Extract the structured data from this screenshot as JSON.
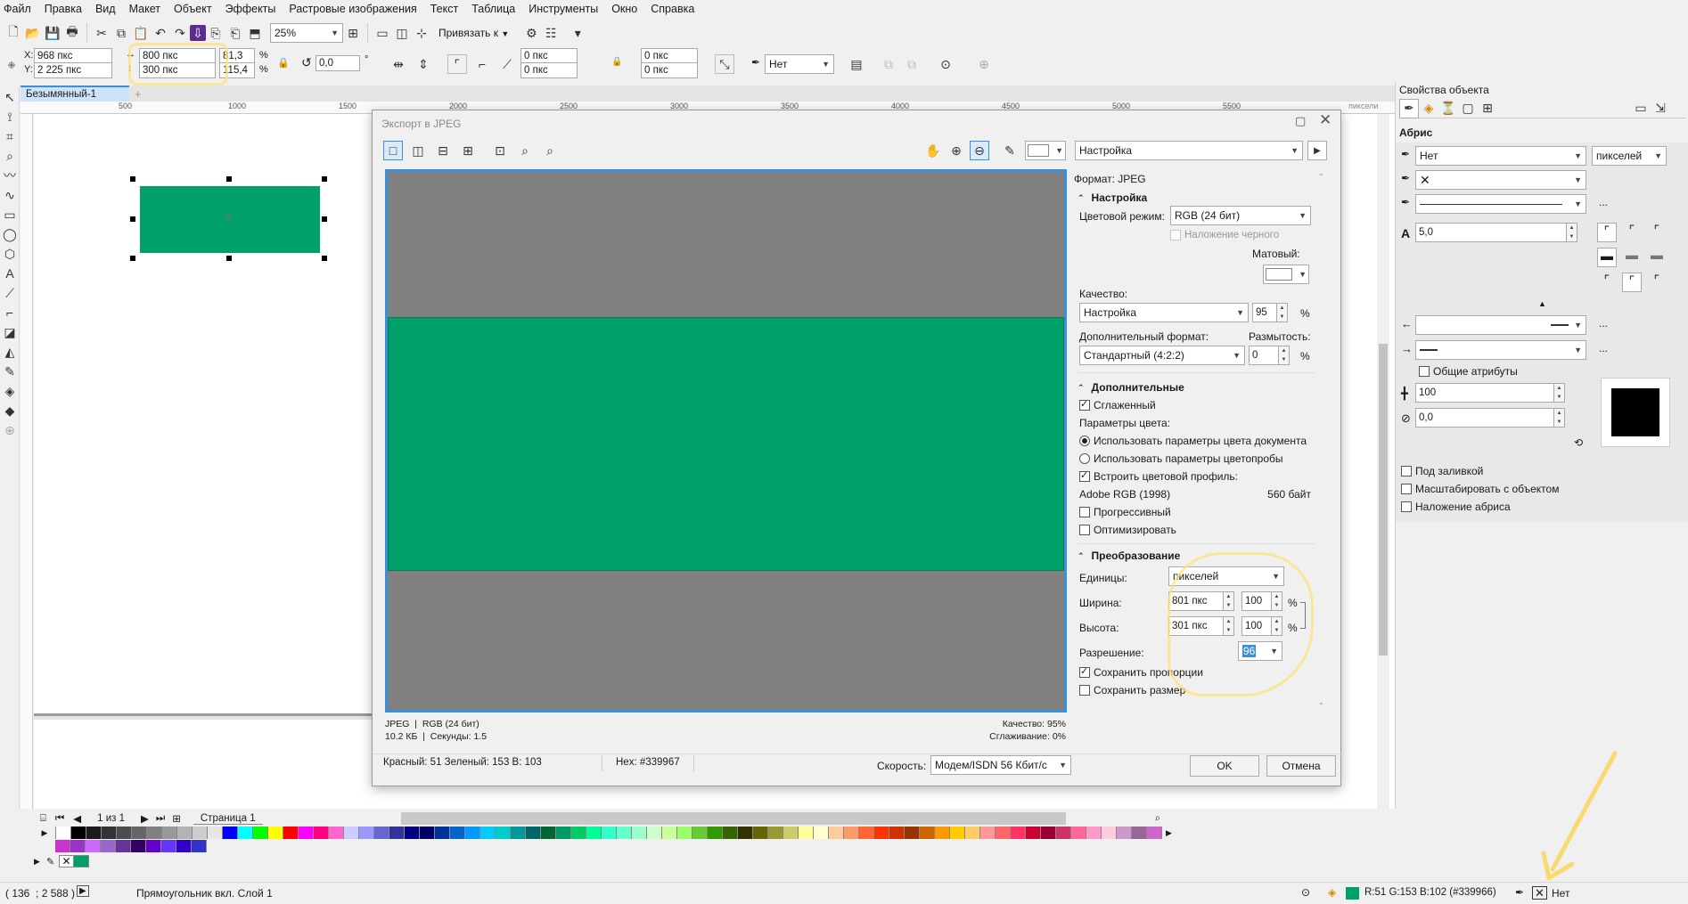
{
  "menu": [
    "Файл",
    "Правка",
    "Вид",
    "Макет",
    "Объект",
    "Эффекты",
    "Растровые изображения",
    "Текст",
    "Таблица",
    "Инструменты",
    "Окно",
    "Справка"
  ],
  "toolbar": {
    "zoom": "25%",
    "snap_label": "Привязать к"
  },
  "propbar": {
    "x_label": "X:",
    "x": "968 пкс",
    "y_label": "Y:",
    "y": "2 225 пкс",
    "w": "800 пкс",
    "h": "300 пкс",
    "w_pct": "81,3",
    "h_pct": "115,4",
    "pct": "%",
    "angle": "0,0",
    "deg": "°",
    "c1": "0 пкс",
    "c2": "0 пкс",
    "c3": "0 пкс",
    "c4": "0 пкс",
    "outline": "Нет"
  },
  "doc_tab": "Безымянный-1",
  "ruler": {
    "ticks": [
      "500",
      "1000",
      "1500",
      "2000",
      "2500",
      "3000",
      "3500",
      "4000",
      "4500",
      "5000",
      "5500"
    ],
    "unit": "пиксели"
  },
  "dialog": {
    "title": "Экспорт в JPEG",
    "preset": "Настройка",
    "format_label": "Формат: JPEG",
    "settings": {
      "header": "Настройка",
      "color_mode_label": "Цветовой режим:",
      "color_mode": "RGB (24 бит)",
      "overprint": "Наложение черного",
      "matte_label": "Матовый:",
      "quality_label": "Качество:",
      "quality": "Настройка",
      "quality_value": "95",
      "pct": "%",
      "subformat_label": "Дополнительный формат:",
      "subformat": "Стандартный (4:2:2)",
      "blur_label": "Размытость:",
      "blur_value": "0"
    },
    "advanced": {
      "header": "Дополнительные",
      "antialias": "Сглаженный",
      "color_params": "Параметры цвета:",
      "use_doc": "Использовать параметры цвета документа",
      "use_proof": "Использовать параметры цветопробы",
      "embed": "Встроить цветовой профиль:",
      "profile": "Adobe RGB (1998)",
      "profile_size": "560 байт",
      "progressive": "Прогрессивный",
      "optimize": "Оптимизировать"
    },
    "transform": {
      "header": "Преобразование",
      "units_label": "Единицы:",
      "units": "пикселей",
      "width_label": "Ширина:",
      "width": "801 пкс",
      "width_pct": "100",
      "height_label": "Высота:",
      "height": "301 пкс",
      "height_pct": "100",
      "pct": "%",
      "res_label": "Разрешение:",
      "res": "96",
      "keep_ratio": "Сохранить пропорции",
      "keep_size": "Сохранить размер"
    },
    "preview_info": {
      "left1": "JPEG  |  RGB (24 бит)",
      "left2": "10.2 КБ  |  Секунды: 1.5",
      "right1": "Качество: 95%",
      "right2": "Сглаживание: 0%"
    },
    "bottom": {
      "rgb": "Красный: 51 Зеленый: 153 B: 103",
      "hex": "Hex: #339967",
      "speed_label": "Скорость:",
      "speed": "Модем/ISDN 56 Кбит/с",
      "ok": "OK",
      "cancel": "Отмена"
    }
  },
  "props_panel": {
    "title": "Свойства объекта",
    "section": "Абрис",
    "outline_width": "Нет",
    "units": "пикселей",
    "miter": "5,0",
    "common_attrs": "Общие атрибуты",
    "stretch": "100",
    "angle": "0,0",
    "behind_fill": "Под заливкой",
    "scale_obj": "Масштабировать с объектом",
    "overprint": "Наложение абриса",
    "more": "..."
  },
  "page_nav": {
    "count": "1 из 1",
    "page": "Страница 1"
  },
  "status": {
    "coords": "( 136  ; 2 588 )",
    "object": "Прямоугольник вкл. Слой 1",
    "fill": "R:51 G:153 B:102 (#339966)",
    "outline": "Нет"
  },
  "colors": {
    "green": "#00a06b",
    "preview_gray": "#808080",
    "accent": "#3b8fd8"
  },
  "palette_row1": [
    "#ffffff",
    "#000000",
    "#1a1a1a",
    "#333333",
    "#4d4d4d",
    "#666666",
    "#808080",
    "#999999",
    "#b3b3b3",
    "#cccccc",
    "#e6e6e6",
    "#0000ff",
    "#00ffff",
    "#00ff00",
    "#ffff00",
    "#ff0000",
    "#ff00ff",
    "#ff0080",
    "#ff66cc",
    "#ccccff",
    "#9999ff",
    "#6666cc",
    "#333399",
    "#000080",
    "#000066",
    "#003399",
    "#0066cc",
    "#0099ff",
    "#00ccff",
    "#00cccc",
    "#009999",
    "#006666",
    "#006633",
    "#009966",
    "#00cc66",
    "#00ff99",
    "#33ffcc",
    "#66ffcc",
    "#99ffcc",
    "#ccffcc",
    "#ccff99",
    "#99ff66",
    "#66cc33",
    "#339900",
    "#336600",
    "#333300",
    "#666600",
    "#999933",
    "#cccc66",
    "#ffff99",
    "#ffffcc",
    "#ffcc99",
    "#ff9966",
    "#ff6633",
    "#ff3300",
    "#cc3300",
    "#993300",
    "#cc6600",
    "#ff9900",
    "#ffcc00",
    "#ffcc66",
    "#ff9999",
    "#ff6666",
    "#ff3366",
    "#cc0033",
    "#990033",
    "#cc3366",
    "#ff6699",
    "#ff99cc",
    "#ffccdd",
    "#cc99cc",
    "#996699",
    "#cc66cc"
  ],
  "palette_row2": [
    "#cc33cc",
    "#9933cc",
    "#cc66ff",
    "#9966cc",
    "#663399",
    "#330066",
    "#6600cc",
    "#6633ff",
    "#3300cc",
    "#3333cc"
  ]
}
